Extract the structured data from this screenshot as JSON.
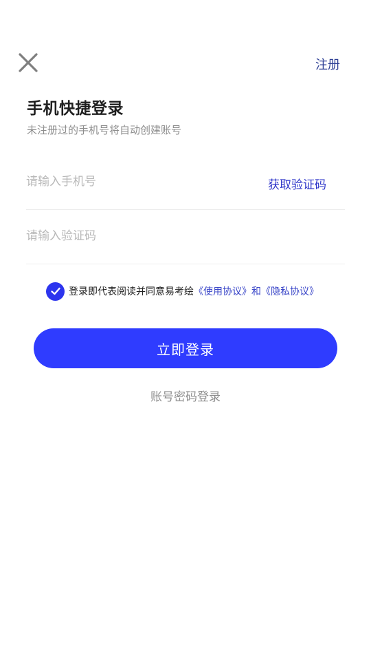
{
  "header": {
    "close_icon": "close-icon",
    "register_label": "注册"
  },
  "title": {
    "main": "手机快捷登录",
    "subtitle": "未注册过的手机号将自动创建账号"
  },
  "form": {
    "phone_placeholder": "请输入手机号",
    "get_code_label": "获取验证码",
    "code_placeholder": "请输入验证码"
  },
  "agreement": {
    "checked": true,
    "prefix": "登录即代表阅读并同意易考绘",
    "user_agreement": "《使用协议》",
    "and": "和",
    "privacy_agreement": "《隐私协议》"
  },
  "actions": {
    "login_label": "立即登录",
    "password_login_label": "账号密码登录"
  },
  "colors": {
    "accent": "#2f3cff",
    "link": "#2d35c9",
    "placeholder": "#b8b8b8",
    "muted": "#8c8c8c"
  }
}
